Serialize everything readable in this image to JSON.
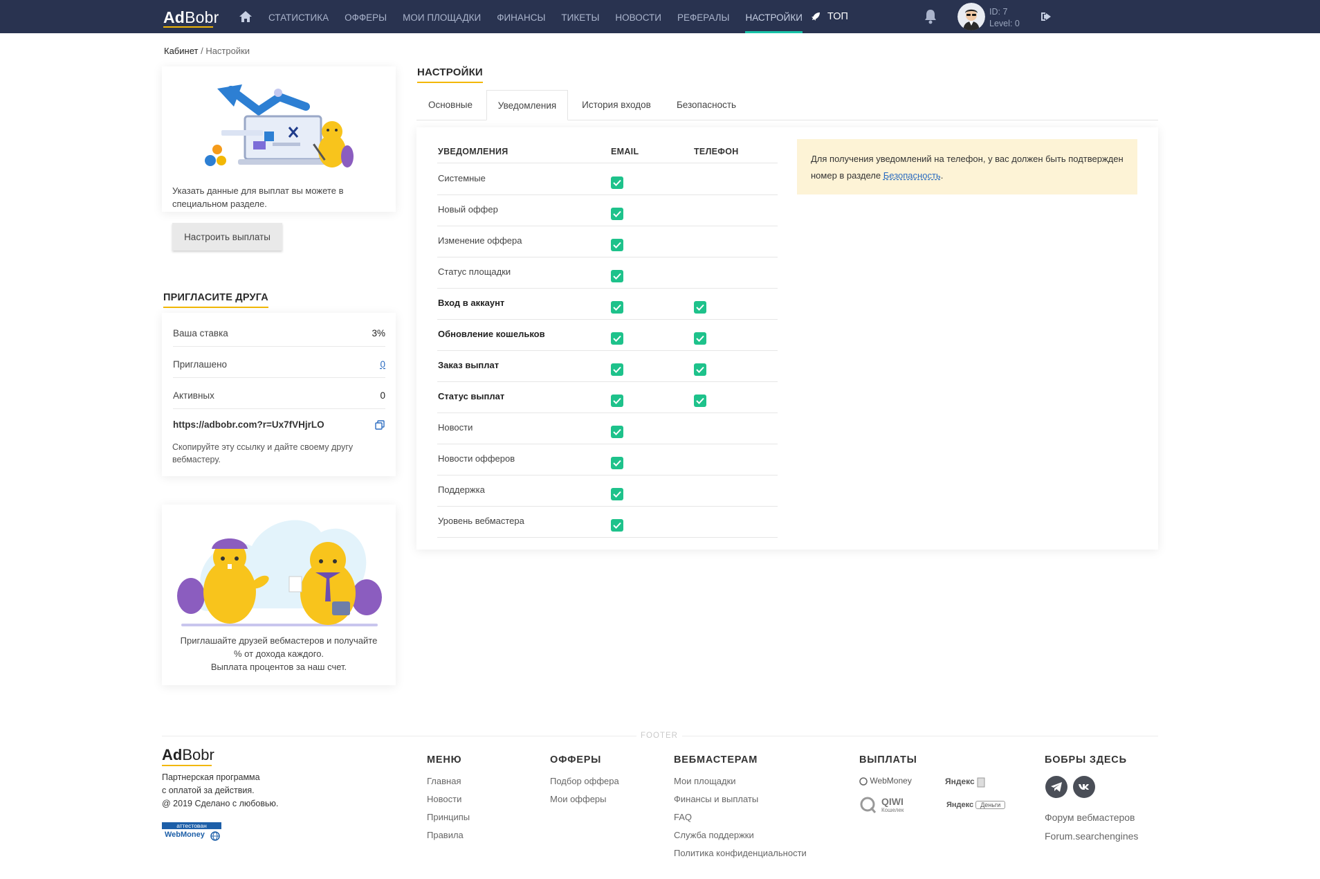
{
  "header": {
    "logo_bold": "Ad",
    "logo_rest": "Bobr",
    "nav": [
      "СТАТИСТИКА",
      "ОФФЕРЫ",
      "МОИ ПЛОЩАДКИ",
      "ФИНАНСЫ",
      "ТИКЕТЫ",
      "НОВОСТИ",
      "РЕФЕРАЛЫ",
      "НАСТРОЙКИ"
    ],
    "active_nav": "НАСТРОЙКИ",
    "top_label": "ТОП",
    "user_id": "ID: 7",
    "user_level": "Level: 0"
  },
  "breadcrumb": {
    "root": "Кабинет",
    "current": "Настройки"
  },
  "payout_card": {
    "text": "Указать данные для выплат вы можете в специальном разделе.",
    "button": "Настроить выплаты"
  },
  "invite": {
    "title": "ПРИГЛАСИТЕ ДРУГА",
    "rows": [
      {
        "label": "Ваша ставка",
        "value": "3%"
      },
      {
        "label": "Приглашено",
        "value": "0"
      },
      {
        "label": "Активных",
        "value": "0"
      }
    ],
    "ref_link": "https://adbobr.com?r=Ux7fVHjrLO",
    "note": "Скопируйте эту ссылку и дайте своему другу вебмастеру."
  },
  "promo": {
    "line1": "Приглашайте друзей вебмастеров и получайте",
    "line2": "% от дохода каждого.",
    "line3": "Выплата процентов за наш счет."
  },
  "settings": {
    "title": "НАСТРОЙКИ",
    "tabs": [
      "Основные",
      "Уведомления",
      "История входов",
      "Безопасность"
    ],
    "active_tab": "Уведомления",
    "columns": [
      "УВЕДОМЛЕНИЯ",
      "EMAIL",
      "ТЕЛЕФОН"
    ],
    "rows": [
      {
        "label": "Системные",
        "email": true,
        "phone": false,
        "bold": false
      },
      {
        "label": "Новый оффер",
        "email": true,
        "phone": false,
        "bold": false
      },
      {
        "label": "Изменение оффера",
        "email": true,
        "phone": false,
        "bold": false
      },
      {
        "label": "Статус площадки",
        "email": true,
        "phone": false,
        "bold": false
      },
      {
        "label": "Вход в аккаунт",
        "email": true,
        "phone": true,
        "bold": true
      },
      {
        "label": "Обновление кошельков",
        "email": true,
        "phone": true,
        "bold": true
      },
      {
        "label": "Заказ выплат",
        "email": true,
        "phone": true,
        "bold": true
      },
      {
        "label": "Статус выплат",
        "email": true,
        "phone": true,
        "bold": true
      },
      {
        "label": "Новости",
        "email": true,
        "phone": false,
        "bold": false
      },
      {
        "label": "Новости офферов",
        "email": true,
        "phone": false,
        "bold": false
      },
      {
        "label": "Поддержка",
        "email": true,
        "phone": false,
        "bold": false
      },
      {
        "label": "Уровень вебмастера",
        "email": true,
        "phone": false,
        "bold": false
      }
    ],
    "notice_text": "Для получения уведомлений на телефон, у вас должен быть подтвержден номер в разделе",
    "notice_link": "Безопасность",
    "notice_end": "."
  },
  "footer": {
    "tag": "FOOTER",
    "logo_bold": "Ad",
    "logo_rest": "Bobr",
    "desc1": "Партнерская программа",
    "desc2": "с оплатой за действия.",
    "desc3": "@ 2019 Сделано с любовью.",
    "badge_top": "аттестован",
    "badge_bottom": "WebMoney",
    "menu_title": "МЕНЮ",
    "menu": [
      "Главная",
      "Новости",
      "Принципы",
      "Правила"
    ],
    "offers_title": "ОФФЕРЫ",
    "offers": [
      "Подбор оффера",
      "Мои офферы"
    ],
    "webmasters_title": "ВЕБМАСТЕРАМ",
    "webmasters": [
      "Мои площадки",
      "Финансы и выплаты",
      "FAQ",
      "Служба поддержки",
      "Политика конфиденциальности"
    ],
    "payouts_title": "ВЫПЛАТЫ",
    "pay_webmoney": "WebMoney",
    "pay_yandex": "Яндекс",
    "pay_qiwi": "QIWI",
    "pay_qiwi_sub": "Кошелек",
    "pay_ym": "Яндекс",
    "pay_ym_sub": "Деньги",
    "social_title": "БОБРЫ ЗДЕСЬ",
    "social_links": [
      "Форум вебмастеров",
      "Forum.searchengines"
    ]
  },
  "colors": {
    "topbar": "#293350",
    "accent_yellow": "#f2b705",
    "nav_active_underline": "#19c3a8",
    "checkbox_green": "#1ec28b",
    "notice_bg": "#fdf3d6",
    "link_blue": "#2a6bc0"
  }
}
